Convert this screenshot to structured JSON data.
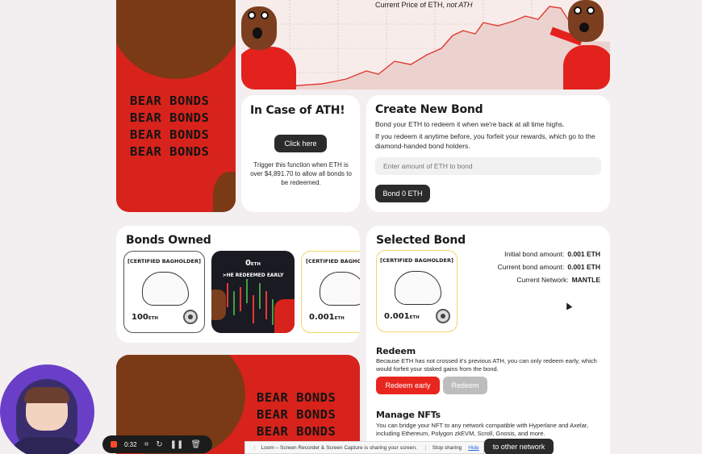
{
  "chart": {
    "title": "Current Price of ETH,",
    "title_italic": "not ATH"
  },
  "banner_top": {
    "lines": [
      "BEAR BONDS",
      "BEAR BONDS",
      "BEAR BONDS",
      "BEAR BONDS"
    ]
  },
  "ath_card": {
    "title": "In Case of ATH!",
    "button_label": "Click here",
    "description": "Trigger this function when ETH is over $4,891.70 to allow all bonds to be redeemed."
  },
  "create_bond": {
    "title": "Create New Bond",
    "line1": "Bond your ETH to redeem it when we're back at all time highs.",
    "line2": "If you redeem it anytime before, you forfeit your rewards, which go to the diamond-handed bond holders.",
    "input_placeholder": "Enter amount of ETH to bond",
    "button_label": "Bond 0 ETH"
  },
  "bonds_owned": {
    "title": "Bonds Owned",
    "nfts": [
      {
        "label": "[CERTIFIED BAGHOLDER]",
        "amount": "100",
        "unit": "ETH"
      },
      {
        "amount": "0",
        "unit": "ETH",
        "caption": ">HE REDEEMED EARLY"
      },
      {
        "label": "[CERTIFIED BAGHOLDER]",
        "amount": "0.001",
        "unit": "ETH"
      }
    ]
  },
  "selected_bond": {
    "title": "Selected Bond",
    "nft": {
      "label": "[CERTIFIED BAGHOLDER]",
      "amount": "0.001",
      "unit": "ETH"
    },
    "initial_label": "Initial bond amount:",
    "initial_value": "0.001 ETH",
    "current_label": "Current bond amount:",
    "current_value": "0.001 ETH",
    "network_label": "Current Network:",
    "network_value": "MANTLE",
    "redeem_title": "Redeem",
    "redeem_desc": "Because ETH has not crossed it's previous ATH, you can only redeem early, which would forfeit your staked gains from the bond.",
    "redeem_early_label": "Redeem early",
    "redeem_label": "Redeem",
    "manage_title": "Manage NFTs",
    "manage_desc": "You can bridge your NFT to any network compatible with Hyperlane and Axelar, including Ethereum, Polygon zkEVM, Scroll, Gnosis, and more.",
    "bridge_button_label": "to other network"
  },
  "banner_bottom": {
    "lines": [
      "BEAR BONDS",
      "BEAR BONDS",
      "BEAR BONDS"
    ]
  },
  "recorder": {
    "time": "0:32"
  },
  "share_bar": {
    "text": "Loom – Screen Recorder & Screen Capture is sharing your screen.",
    "stop_label": "Stop sharing",
    "hide_label": "Hide"
  },
  "colors": {
    "brand_red": "#e8261e",
    "brown": "#7a3a15",
    "dark": "#2b2b2b"
  }
}
